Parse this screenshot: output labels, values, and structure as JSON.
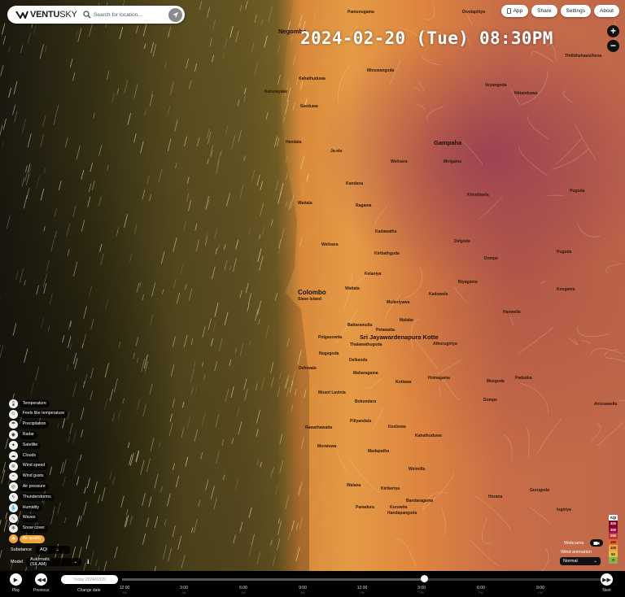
{
  "brand": {
    "name_bold": "VENTU",
    "name_light": "SKY"
  },
  "search": {
    "placeholder": "Search for location..."
  },
  "top_buttons": [
    "App",
    "Share",
    "Settings",
    "About"
  ],
  "zoom": {
    "in": "+",
    "out": "−"
  },
  "datetime": "2024-02-20 (Tue) 08:30PM",
  "map_places": {
    "negombo": "Negombo",
    "ja_ela": "Ja-ela",
    "gampaha": "Gampaha",
    "colombo": "Colombo",
    "slave_island": "Slave Island",
    "kotte": "Sri Jayawardenapura Kotte",
    "minuwangoda": "Minuwangoda",
    "kandana": "Kandana",
    "wattala": "Wattala",
    "kiribathgoda": "Kiribathgoda",
    "kelaniya": "Kelaniya",
    "kaduwela": "Kaduwela",
    "battaramulla": "Battaramulla",
    "nugegoda": "Nugegoda",
    "dehiwala": "Dehiwala",
    "maharagama": "Maharagama",
    "homagama": "Homagama",
    "mount_lavinia": "Mount Lavinia",
    "moratuwa": "Moratuwa",
    "rawathawatta": "Rawathawatta",
    "piliyandala": "Piliyandala",
    "kesbewa": "Kesbewa",
    "panadura": "Panadura",
    "bandaragama": "Bandaragama",
    "horana": "Horana",
    "padukka": "Padukka",
    "hanwella": "Hanwella",
    "kosgama": "Kosgama",
    "avissawella": "Avissawella",
    "meegoda": "Meegoda",
    "kottawa": "Kottawa",
    "malabe": "Malabe",
    "mirigama": "Mirigama",
    "nittambuwa": "Nittambuwa",
    "divulapitiya": "Divulapitiya",
    "veyangoda": "Veyangoda",
    "pugoda": "Pugoda",
    "kirindiwela": "Kirindiwela",
    "dompe": "Dompe",
    "delgoda": "Delgoda",
    "biyagama": "Biyagama",
    "kalutara_road": "Kahathuduwa",
    "ingiriya": "Ingiriya",
    "gurugoda": "Gurugoda",
    "pannala": "Pamunugama",
    "welisara": "Welisara",
    "katunayake": "Katunayake",
    "seeduwa": "Seeduwa",
    "hendala": "Hendala",
    "kadawatha": "Kadawatha",
    "ragama": "Ragama",
    "athurugiriya": "Athurugiriya",
    "mulleriyawa": "Mulleriyawa",
    "thalawathugoda": "Thalawathugoda",
    "delkanda": "Delkanda",
    "pelawatta": "Pelawatta",
    "kahathuduwa": "Kahathuduwa",
    "polgasowita": "Polgasowita",
    "madapatha": "Madapatha",
    "welmilla": "Welmilla",
    "walana": "Walana",
    "kiribeiya": "Kiriberiya",
    "kuruwita": "Kuruwita",
    "handapangoda": "Handapangoda",
    "tithtahawelhena": "Thiththahawelhena",
    "wakata": "Waga",
    "bokundara": "Bokundara"
  },
  "layers": [
    {
      "icon": "thermometer-icon",
      "glyph": "🌡",
      "label": "Temperature",
      "active": false
    },
    {
      "icon": "feels-like-icon",
      "glyph": "☺",
      "label": "Feels like temperature",
      "active": false
    },
    {
      "icon": "precipitation-icon",
      "glyph": "☂",
      "label": "Precipitation",
      "active": false
    },
    {
      "icon": "radar-icon",
      "glyph": "◉",
      "label": "Radar",
      "active": false
    },
    {
      "icon": "satellite-icon",
      "glyph": "✦",
      "label": "Satellite",
      "active": false
    },
    {
      "icon": "clouds-icon",
      "glyph": "☁",
      "label": "Clouds",
      "active": false
    },
    {
      "icon": "wind-speed-icon",
      "glyph": "≋",
      "label": "Wind speed",
      "active": false
    },
    {
      "icon": "wind-gusts-icon",
      "glyph": "≈",
      "label": "Wind gusts",
      "active": false
    },
    {
      "icon": "air-pressure-icon",
      "glyph": "◎",
      "label": "Air pressure",
      "active": false
    },
    {
      "icon": "thunderstorm-icon",
      "glyph": "ϟ",
      "label": "Thunderstorms",
      "active": false
    },
    {
      "icon": "humidity-icon",
      "glyph": "💧",
      "label": "Humidity",
      "active": false
    },
    {
      "icon": "waves-icon",
      "glyph": "∿",
      "label": "Waves",
      "active": false
    },
    {
      "icon": "snow-cover-icon",
      "glyph": "❄",
      "label": "Snow cover",
      "active": false
    },
    {
      "icon": "air-quality-icon",
      "glyph": "☘",
      "label": "Air quality",
      "active": true
    }
  ],
  "substance": {
    "label": "Substance",
    "value": "AQI"
  },
  "model": {
    "label": "Model",
    "value": "Automatic (SILAM)"
  },
  "aqi_legend": {
    "title": "AQI",
    "steps": [
      "400",
      "300",
      "200",
      "150",
      "100",
      "50",
      "0"
    ],
    "colors": [
      "#7e0023",
      "#99004c",
      "#c0392b",
      "#e8643a",
      "#f2a13c",
      "#d9c34a",
      "#8ab04e"
    ]
  },
  "webcams": {
    "label": "Webcams"
  },
  "wind": {
    "label": "Wind animation",
    "value": "Normal"
  },
  "timeline": {
    "play": "Play",
    "previous": "Previous",
    "next": "Next",
    "change_date": "Change date",
    "date_value": "Today 2024/02/20",
    "progress": 0.63,
    "ticks": [
      {
        "t": "12:00",
        "d": "AM"
      },
      {
        "t": "3:00",
        "d": "AM"
      },
      {
        "t": "6:00",
        "d": "AM"
      },
      {
        "t": "9:00",
        "d": "AM"
      },
      {
        "t": "12:00",
        "d": "PM"
      },
      {
        "t": "3:00",
        "d": "PM"
      },
      {
        "t": "6:00",
        "d": "PM"
      },
      {
        "t": "9:00",
        "d": "PM"
      }
    ]
  }
}
